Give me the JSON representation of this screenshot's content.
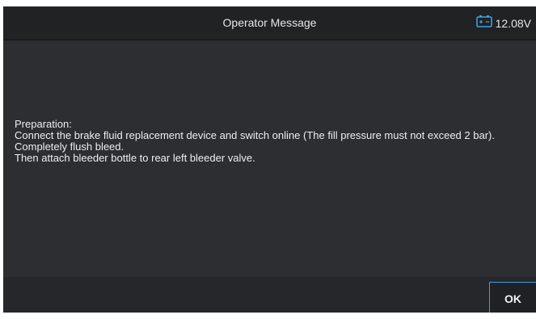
{
  "header": {
    "title": "Operator Message",
    "battery_voltage": "12.08V",
    "battery_icon": "battery-icon",
    "accent_color": "#3da2e0"
  },
  "message": {
    "lines": [
      "Preparation:",
      "Connect the brake fluid replacement device and switch online (The fill pressure must not exceed 2 bar).",
      "Completely flush bleed.",
      "Then attach bleeder bottle to rear left bleeder valve."
    ]
  },
  "footer": {
    "ok_label": "OK"
  }
}
